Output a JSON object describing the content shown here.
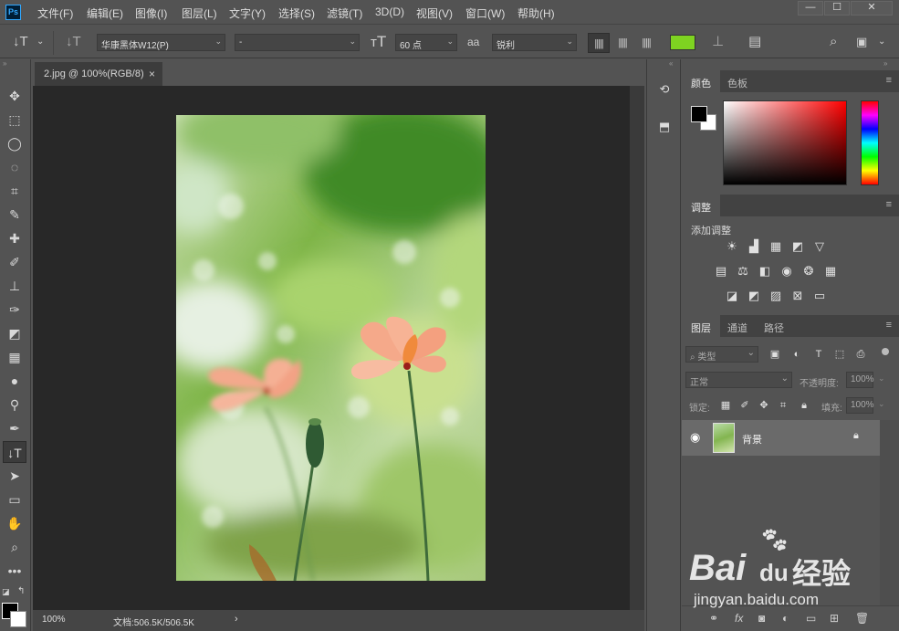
{
  "app": {
    "logo": "Ps",
    "menu": [
      "文件(F)",
      "编辑(E)",
      "图像(I)",
      "图层(L)",
      "文字(Y)",
      "选择(S)",
      "滤镜(T)",
      "3D(D)",
      "视图(V)",
      "窗口(W)",
      "帮助(H)"
    ],
    "window_controls": [
      "—",
      "☐",
      "✕"
    ]
  },
  "options": {
    "font_family": "华康黑体W12(P)",
    "font_style": "-",
    "font_size": "60 点",
    "aa_label": "aa",
    "antialias": "锐利",
    "text_color": "#7ed321"
  },
  "document": {
    "tab_title": "2.jpg @ 100%(RGB/8)",
    "close": "×",
    "zoom": "100%",
    "doc_info": "文档:506.5K/506.5K",
    "status_arrow": "›"
  },
  "panels": {
    "color_tabs": [
      "颜色",
      "色板"
    ],
    "adjust_tab": "调整",
    "adjust_title": "添加调整",
    "layers_tabs": [
      "图层",
      "通道",
      "路径"
    ],
    "layer_filter": "类型",
    "blend_mode": "正常",
    "opacity_label": "不透明度:",
    "opacity_value": "100%",
    "lock_label": "锁定:",
    "fill_label": "填充:",
    "fill_value": "100%",
    "layer_name": "背景",
    "colors": {
      "foreground": "#000000",
      "background": "#ffffff"
    }
  },
  "watermark": {
    "brand": "Bai",
    "paw": "du",
    "cn": "经验",
    "url": "jingyan.baidu.com"
  }
}
